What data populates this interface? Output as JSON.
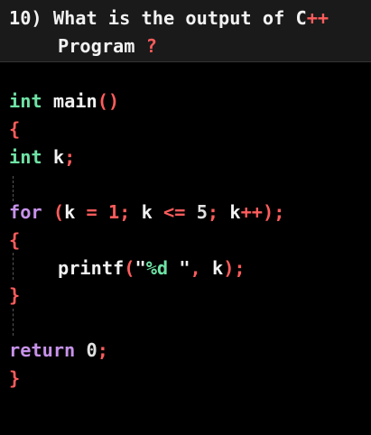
{
  "question": {
    "number": "10)",
    "line1": "What is the output of C",
    "line1_suffix": "++",
    "line2": "Program",
    "line2_suffix": "?"
  },
  "code": {
    "l1": {
      "kw": "int",
      "rest": "main",
      "paren": "()"
    },
    "l2": {
      "brace": "{"
    },
    "l3": {
      "kw": "int",
      "rest": "k",
      "semi": ";"
    },
    "l4": {
      "kw": "for",
      "p1": "(",
      "t1": "k",
      "op1": "=",
      "n1": "1",
      "s1": ";",
      "t2": "k",
      "op2": "<=",
      "n2": "5",
      "s2": ";",
      "t3": "k",
      "op3": "++",
      "p2": ")",
      "s3": ";"
    },
    "l5": {
      "brace": "{"
    },
    "l6": {
      "fn": "printf",
      "p1": "(",
      "q1": "\"",
      "fmt": "%d",
      "q2": " \"",
      "comma": ",",
      "arg": "k",
      "p2": ")",
      "semi": ";"
    },
    "l7": {
      "brace": "}"
    },
    "l8": {
      "kw": "return",
      "n": "0",
      "semi": ";"
    },
    "l9": {
      "brace": "}"
    }
  },
  "colors": {
    "keyword_type": "#6ee3a5",
    "keyword_control": "#c792ea",
    "punctuation": "#ff5c5c",
    "text": "#ffffff",
    "header_bg": "#1a1a1a",
    "background": "#000000"
  }
}
